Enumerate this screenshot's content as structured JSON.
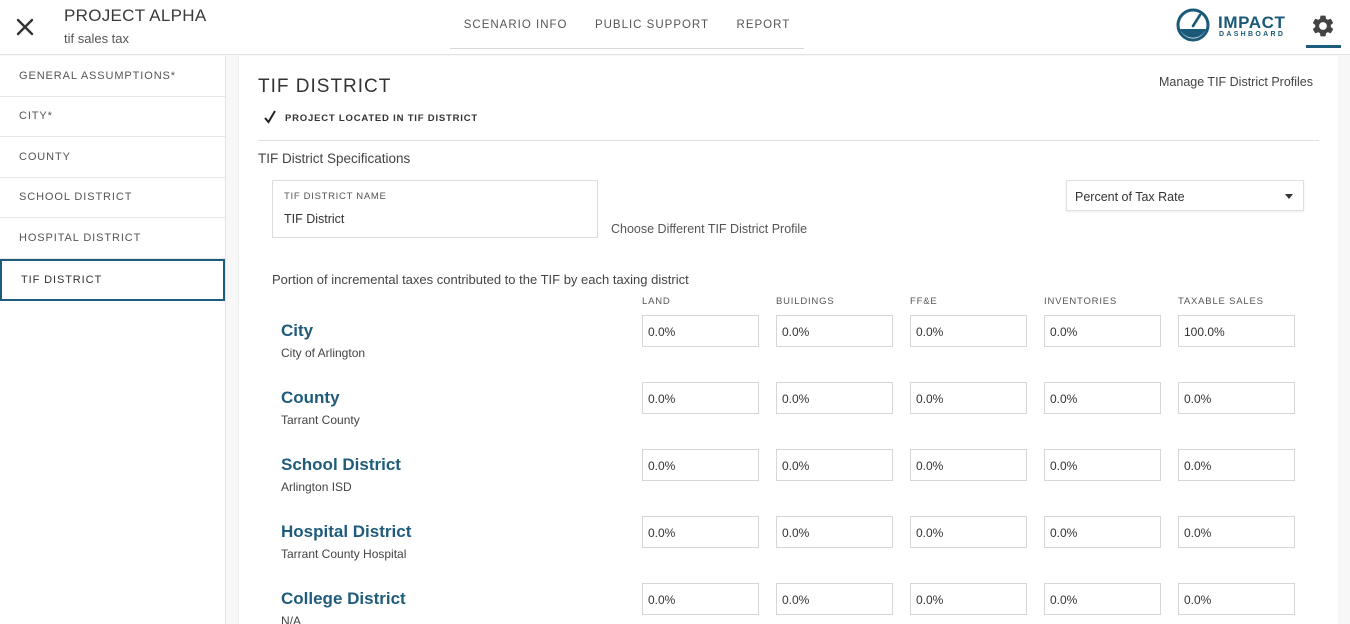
{
  "header": {
    "project_title": "PROJECT ALPHA",
    "project_subtitle": "tif sales tax",
    "nav": [
      "SCENARIO INFO",
      "PUBLIC SUPPORT",
      "REPORT"
    ],
    "logo_text": "IMPACT",
    "logo_subtext": "DASHBOARD",
    "brand_color": "#1a5a78"
  },
  "sidebar": {
    "items": [
      {
        "label": "GENERAL ASSUMPTIONS*"
      },
      {
        "label": "CITY*"
      },
      {
        "label": "COUNTY"
      },
      {
        "label": "SCHOOL DISTRICT"
      },
      {
        "label": "HOSPITAL DISTRICT"
      },
      {
        "label": "TIF DISTRICT"
      }
    ],
    "active": "TIF DISTRICT"
  },
  "main": {
    "title": "TIF DISTRICT",
    "manage_link": "Manage TIF District Profiles",
    "checkbox_label": "PROJECT LOCATED IN TIF DISTRICT",
    "checkbox_checked": true,
    "spec_title": "TIF District Specifications",
    "name_field_label": "TIF DISTRICT NAME",
    "name_field_value": "TIF District",
    "choose_link": "Choose Different TIF District Profile",
    "select_value": "Percent of Tax Rate",
    "portion_text": "Portion of incremental taxes contributed to the TIF by each taxing district",
    "columns": [
      "LAND",
      "BUILDINGS",
      "FF&E",
      "INVENTORIES",
      "TAXABLE SALES"
    ],
    "rows": [
      {
        "name": "City",
        "sub": "City of Arlington",
        "values": [
          "0.0%",
          "0.0%",
          "0.0%",
          "0.0%",
          "100.0%"
        ]
      },
      {
        "name": "County",
        "sub": "Tarrant County",
        "values": [
          "0.0%",
          "0.0%",
          "0.0%",
          "0.0%",
          "0.0%"
        ]
      },
      {
        "name": "School District",
        "sub": "Arlington ISD",
        "values": [
          "0.0%",
          "0.0%",
          "0.0%",
          "0.0%",
          "0.0%"
        ]
      },
      {
        "name": "Hospital District",
        "sub": "Tarrant County Hospital",
        "values": [
          "0.0%",
          "0.0%",
          "0.0%",
          "0.0%",
          "0.0%"
        ]
      },
      {
        "name": "College District",
        "sub": "N/A",
        "values": [
          "0.0%",
          "0.0%",
          "0.0%",
          "0.0%",
          "0.0%"
        ]
      }
    ]
  }
}
